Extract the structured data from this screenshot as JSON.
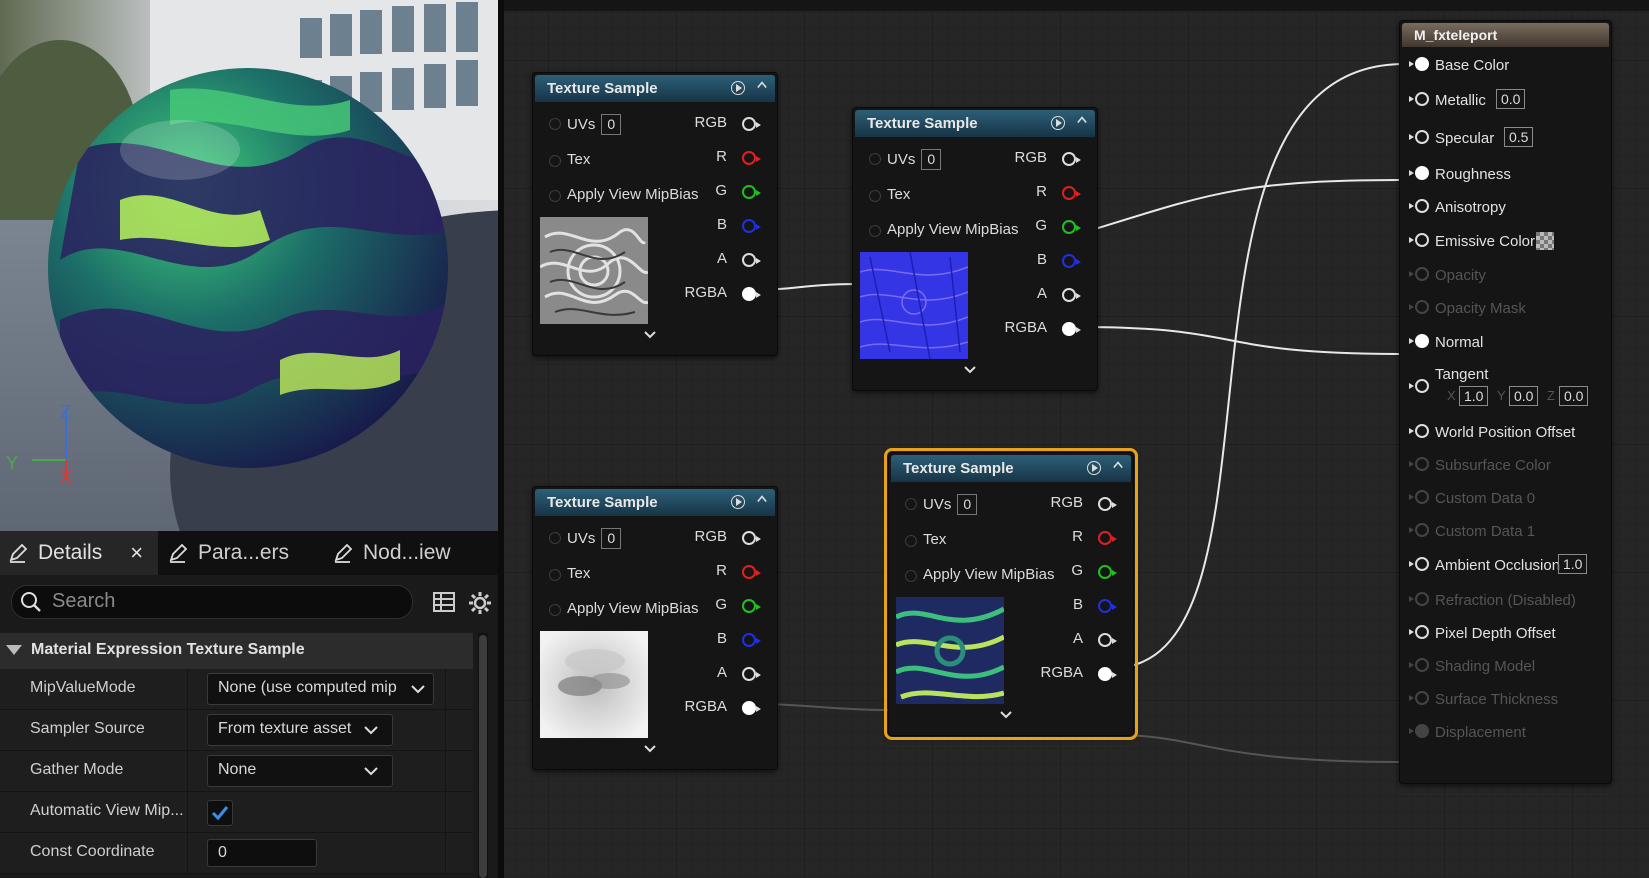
{
  "viewport": {
    "axis_labels": {
      "z": "Z",
      "y": "Y",
      "x": "X"
    }
  },
  "details_panel": {
    "tabs": [
      {
        "label": "Details",
        "active": true,
        "close": "×"
      },
      {
        "label": "Para...ers"
      },
      {
        "label": "Nod...iew"
      }
    ],
    "search_placeholder": "Search",
    "category": "Material Expression Texture Sample",
    "properties": [
      {
        "name": "MipValueMode",
        "value": "None (use computed mip"
      },
      {
        "name": "Sampler Source",
        "value": "From texture asset"
      },
      {
        "name": "Gather Mode",
        "value": "None"
      },
      {
        "name": "Automatic View Mip...",
        "checked": true
      },
      {
        "name": "Const Coordinate",
        "value": "0"
      }
    ]
  },
  "graph": {
    "nodes": [
      {
        "title": "Texture Sample",
        "uvs": "0",
        "inputs": [
          "UVs",
          "Tex",
          "Apply View MipBias"
        ],
        "outputs": [
          "RGB",
          "R",
          "G",
          "B",
          "A",
          "RGBA"
        ]
      },
      {
        "title": "Texture Sample",
        "uvs": "0",
        "inputs": [
          "UVs",
          "Tex",
          "Apply View MipBias"
        ],
        "outputs": [
          "RGB",
          "R",
          "G",
          "B",
          "A",
          "RGBA"
        ]
      },
      {
        "title": "Texture Sample",
        "uvs": "0",
        "inputs": [
          "UVs",
          "Tex",
          "Apply View MipBias"
        ],
        "outputs": [
          "RGB",
          "R",
          "G",
          "B",
          "A",
          "RGBA"
        ]
      },
      {
        "title": "Texture Sample",
        "uvs": "0",
        "inputs": [
          "UVs",
          "Tex",
          "Apply View MipBias"
        ],
        "outputs": [
          "RGB",
          "R",
          "G",
          "B",
          "A",
          "RGBA"
        ],
        "selected": true
      }
    ],
    "material": {
      "title": "M_fxteleport",
      "inputs": [
        {
          "label": "Base Color",
          "connected": true
        },
        {
          "label": "Metallic",
          "value": "0.0"
        },
        {
          "label": "Specular",
          "value": "0.5"
        },
        {
          "label": "Roughness",
          "connected": true
        },
        {
          "label": "Anisotropy"
        },
        {
          "label": "Emissive Color"
        },
        {
          "label": "Opacity",
          "disabled": true
        },
        {
          "label": "Opacity Mask",
          "disabled": true
        },
        {
          "label": "Normal",
          "connected": true
        },
        {
          "label": "Tangent",
          "x_label": "X",
          "x": "1.0",
          "y_label": "Y",
          "y": "0.0",
          "z_label": "Z",
          "z": "0.0"
        },
        {
          "label": "World Position Offset"
        },
        {
          "label": "Subsurface Color",
          "disabled": true
        },
        {
          "label": "Custom Data 0",
          "disabled": true
        },
        {
          "label": "Custom Data 1",
          "disabled": true
        },
        {
          "label": "Ambient Occlusion",
          "value": "1.0"
        },
        {
          "label": "Refraction (Disabled)",
          "disabled": true
        },
        {
          "label": "Pixel Depth Offset"
        },
        {
          "label": "Shading Model",
          "disabled": true
        },
        {
          "label": "Surface Thickness",
          "disabled": true
        },
        {
          "label": "Displacement",
          "disabled": true
        }
      ]
    }
  },
  "colors": {
    "selection": "#e8a21a",
    "header_blue": "#2d5f78",
    "material_header": "#7a6c5e",
    "checkbox_check": "#3a8ee6"
  }
}
